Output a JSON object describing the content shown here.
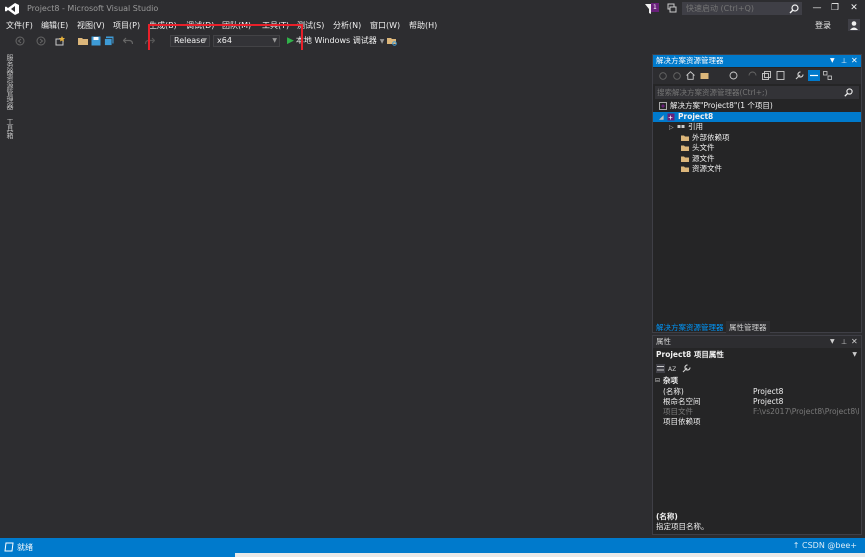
{
  "window": {
    "title": "Project8 - Microsoft Visual Studio",
    "notification_count": "1",
    "quick_launch_placeholder": "快速启动 (Ctrl+Q)",
    "login": "登录",
    "minimize": "—",
    "restore": "❐",
    "close": "✕"
  },
  "menu": [
    "文件(F)",
    "编辑(E)",
    "视图(V)",
    "项目(P)",
    "生成(B)",
    "调试(D)",
    "团队(M)",
    "工具(T)",
    "测试(S)",
    "分析(N)",
    "窗口(W)",
    "帮助(H)"
  ],
  "toolbar": {
    "configuration": "Release",
    "platform": "x64",
    "run_label": "本地 Windows 调试器"
  },
  "left_strip": {
    "server_explorer": "服务器资源管理器",
    "toolbox": "工具箱"
  },
  "solution_explorer": {
    "title": "解决方案资源管理器",
    "search_placeholder": "搜索解决方案资源管理器(Ctrl+;)",
    "solution": "解决方案\"Project8\"(1 个项目)",
    "project": "Project8",
    "items": [
      "引用",
      "外部依赖项",
      "头文件",
      "源文件",
      "资源文件"
    ],
    "tab_active": "解决方案资源管理器",
    "tab_inactive": "属性管理器"
  },
  "properties": {
    "title": "属性",
    "selected": "Project8 项目属性",
    "category": "杂项",
    "rows": [
      {
        "k": "(名称)",
        "v": "Project8"
      },
      {
        "k": "根命名空间",
        "v": "Project8"
      },
      {
        "k": "项目文件",
        "v": "F:\\vs2017\\Project8\\Project8\\Pr"
      },
      {
        "k": "项目依赖项",
        "v": ""
      }
    ],
    "desc_title": "(名称)",
    "desc_text": "指定项目名称。"
  },
  "status": {
    "text": "就绪",
    "right": "↑ CSDN @bee+"
  },
  "colors": {
    "accent": "#007acc",
    "highlight_box": "#e8202a",
    "background": "#2d2d30"
  }
}
